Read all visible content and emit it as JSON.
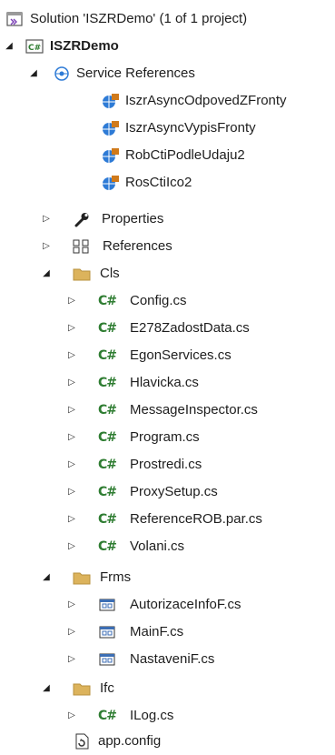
{
  "solution": {
    "label": "Solution 'ISZRDemo' (1 of 1 project)"
  },
  "project": {
    "label": "ISZRDemo"
  },
  "service_references": {
    "label": "Service References",
    "items": [
      "IszrAsyncOdpovedZFronty",
      "IszrAsyncVypisFronty",
      "RobCtiPodleUdaju2",
      "RosCtiIco2"
    ]
  },
  "properties": {
    "label": "Properties"
  },
  "references": {
    "label": "References"
  },
  "cls_folder": {
    "label": "Cls",
    "files": [
      "Config.cs",
      "E278ZadostData.cs",
      "EgonServices.cs",
      "Hlavicka.cs",
      "MessageInspector.cs",
      "Program.cs",
      "Prostredi.cs",
      "ProxySetup.cs",
      "ReferenceROB.par.cs",
      "Volani.cs"
    ]
  },
  "frms_folder": {
    "label": "Frms",
    "files": [
      "AutorizaceInfoF.cs",
      "MainF.cs",
      "NastaveniF.cs"
    ]
  },
  "ifc_folder": {
    "label": "Ifc",
    "files": [
      "ILog.cs"
    ]
  },
  "app_config": {
    "label": "app.config"
  },
  "icons": {
    "expanded": "triangle-expanded-icon",
    "collapsed": "triangle-collapsed-icon",
    "csharp": "csharp-file-icon",
    "form": "form-file-icon",
    "folder": "folder-icon",
    "service": "service-reference-icon"
  },
  "colors": {
    "csharp": "#2f7d32",
    "folder": "#dcb35c",
    "form": "#3c6eb4",
    "service": "#2e7bd6"
  }
}
